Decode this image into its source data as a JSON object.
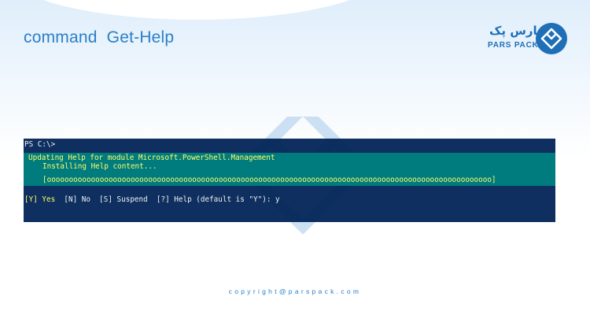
{
  "slide": {
    "title": "command  Get-Help"
  },
  "logo": {
    "persian_text": "پارس پک",
    "latin_text": "PARS PACK",
    "brand_color": "#1e6fb8",
    "mark_icon": "diamond-heart-icon"
  },
  "console": {
    "prompt": "PS C:\\>",
    "progress": {
      "activity": "Updating Help for module Microsoft.PowerShell.Management",
      "status": "Installing Help content...",
      "bar": "[ooooooooooooooooooooooooooooooooooooooooooooooooooooooooooooooooooooooooooooooooooooooooooooooooooooo]"
    },
    "choices": {
      "yes": "[Y] Yes",
      "rest": "  [N] No  [S] Suspend  [?] Help (default is \"Y\"): y"
    },
    "colors": {
      "background": "#012456",
      "progress_background": "#008080",
      "progress_text": "#ffff66",
      "text": "#f2f2f2"
    }
  },
  "footer": {
    "copyright": "copyright@parspack.com"
  },
  "watermark_icon": "diamond-heart-icon"
}
